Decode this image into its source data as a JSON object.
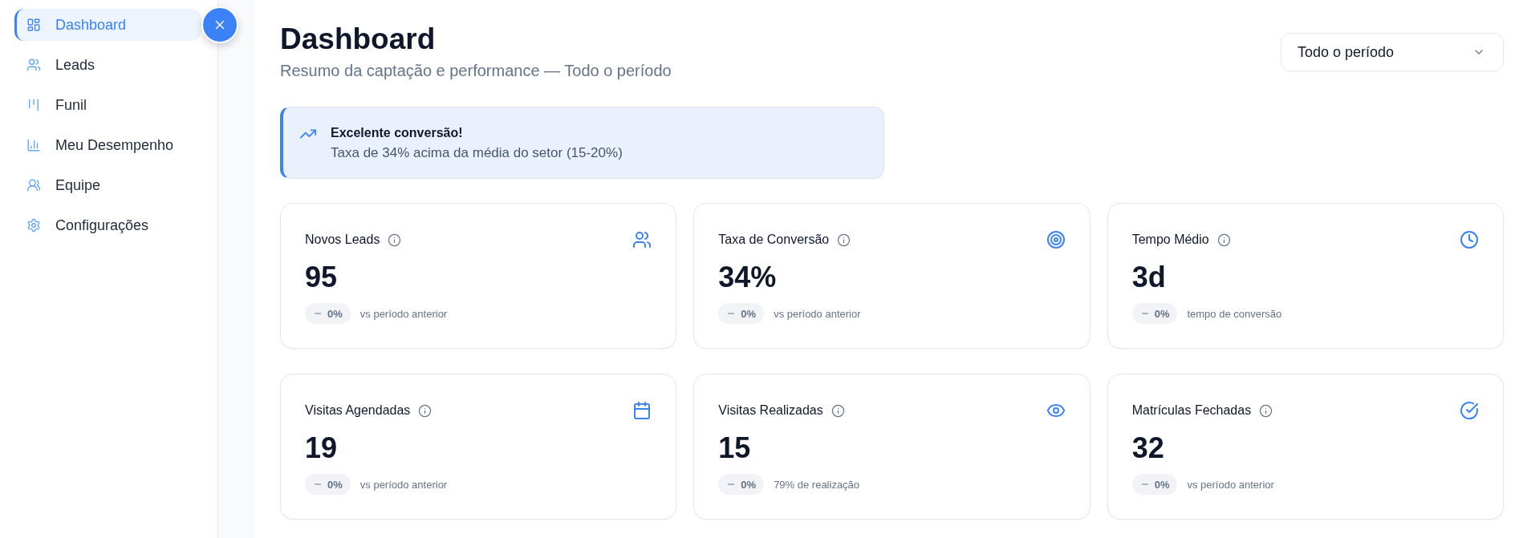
{
  "sidebar": {
    "items": [
      {
        "label": "Dashboard",
        "kind": "grid",
        "selected": true
      },
      {
        "label": "Leads",
        "kind": "users",
        "selected": false
      },
      {
        "label": "Funil",
        "kind": "kanban",
        "selected": false
      },
      {
        "label": "Meu Desempenho",
        "kind": "chart",
        "selected": false
      },
      {
        "label": "Equipe",
        "kind": "team",
        "selected": false
      },
      {
        "label": "Configurações",
        "kind": "gear",
        "selected": false
      }
    ]
  },
  "header": {
    "title": "Dashboard",
    "subtitle": "Resumo da captação e performance — Todo o período"
  },
  "period_select": {
    "value": "Todo o período"
  },
  "insight": {
    "title": "Excelente conversão!",
    "text": "Taxa de 34% acima da média do setor (15-20%)"
  },
  "cards": [
    {
      "title": "Novos Leads",
      "kind": "users",
      "value": "95",
      "change": "0%",
      "note": "vs período anterior"
    },
    {
      "title": "Taxa de Conversão",
      "kind": "target",
      "value": "34%",
      "change": "0%",
      "note": "vs período anterior"
    },
    {
      "title": "Tempo Médio",
      "kind": "clock",
      "value": "3d",
      "change": "0%",
      "note": "tempo de conversão"
    },
    {
      "title": "Visitas Agendadas",
      "kind": "calendar",
      "value": "19",
      "change": "0%",
      "note": "vs período anterior"
    },
    {
      "title": "Visitas Realizadas",
      "kind": "eye",
      "value": "15",
      "change": "0%",
      "note": "79% de realização"
    },
    {
      "title": "Matrículas Fechadas",
      "kind": "check",
      "value": "32",
      "change": "0%",
      "note": "vs período anterior"
    }
  ]
}
